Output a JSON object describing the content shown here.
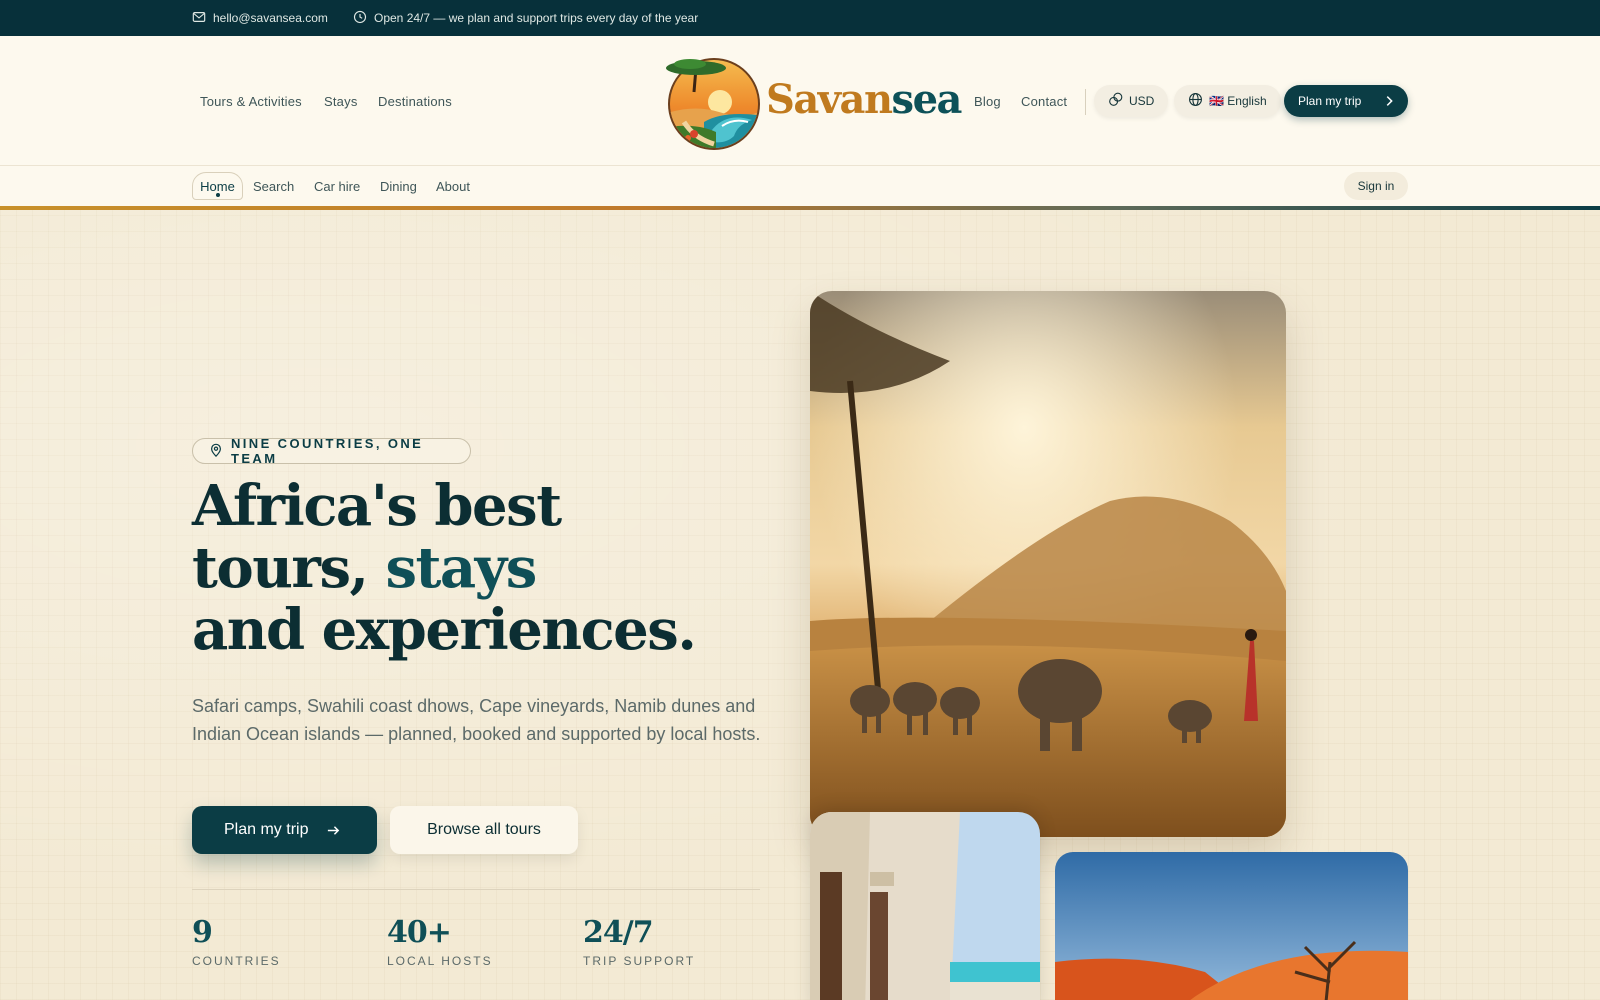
{
  "topbar": {
    "email": "hello@savansea.com",
    "hours": "Open 24/7 — we plan and support trips every day of the year",
    "icons": [
      "mail-icon",
      "clock-icon"
    ]
  },
  "header": {
    "left_nav": [
      "Tours & Activities",
      "Stays",
      "Destinations"
    ],
    "brand": {
      "part1": "Savan",
      "part2": "sea"
    },
    "right_nav": [
      "Blog",
      "Contact"
    ],
    "currency": "USD",
    "language": "🇬🇧 English",
    "cta": "Plan my trip"
  },
  "subnav": {
    "active": "Home",
    "items": [
      "Search",
      "Car hire",
      "Dining",
      "About"
    ],
    "sign_in": "Sign in"
  },
  "hero": {
    "badge": "NINE COUNTRIES, ONE TEAM",
    "title_line1": "Africa's best",
    "title_line2a": "tours, ",
    "title_line2b": "stays",
    "title_line3": "and experiences.",
    "lead": "Safari camps, Swahili coast dhows, Cape vineyards, Namib dunes and Indian Ocean islands — planned, booked and supported by local hosts.",
    "primary_button": "Plan my trip",
    "secondary_button": "Browse all tours",
    "stats": [
      {
        "value": "9",
        "label": "COUNTRIES"
      },
      {
        "value": "40+",
        "label": "LOCAL HOSTS"
      },
      {
        "value": "24/7",
        "label": "TRIP SUPPORT"
      }
    ]
  },
  "colors": {
    "primary": "#0b3d45",
    "accent": "#c07a1e",
    "background": "#f3ead4",
    "topbar": "#07303a"
  }
}
